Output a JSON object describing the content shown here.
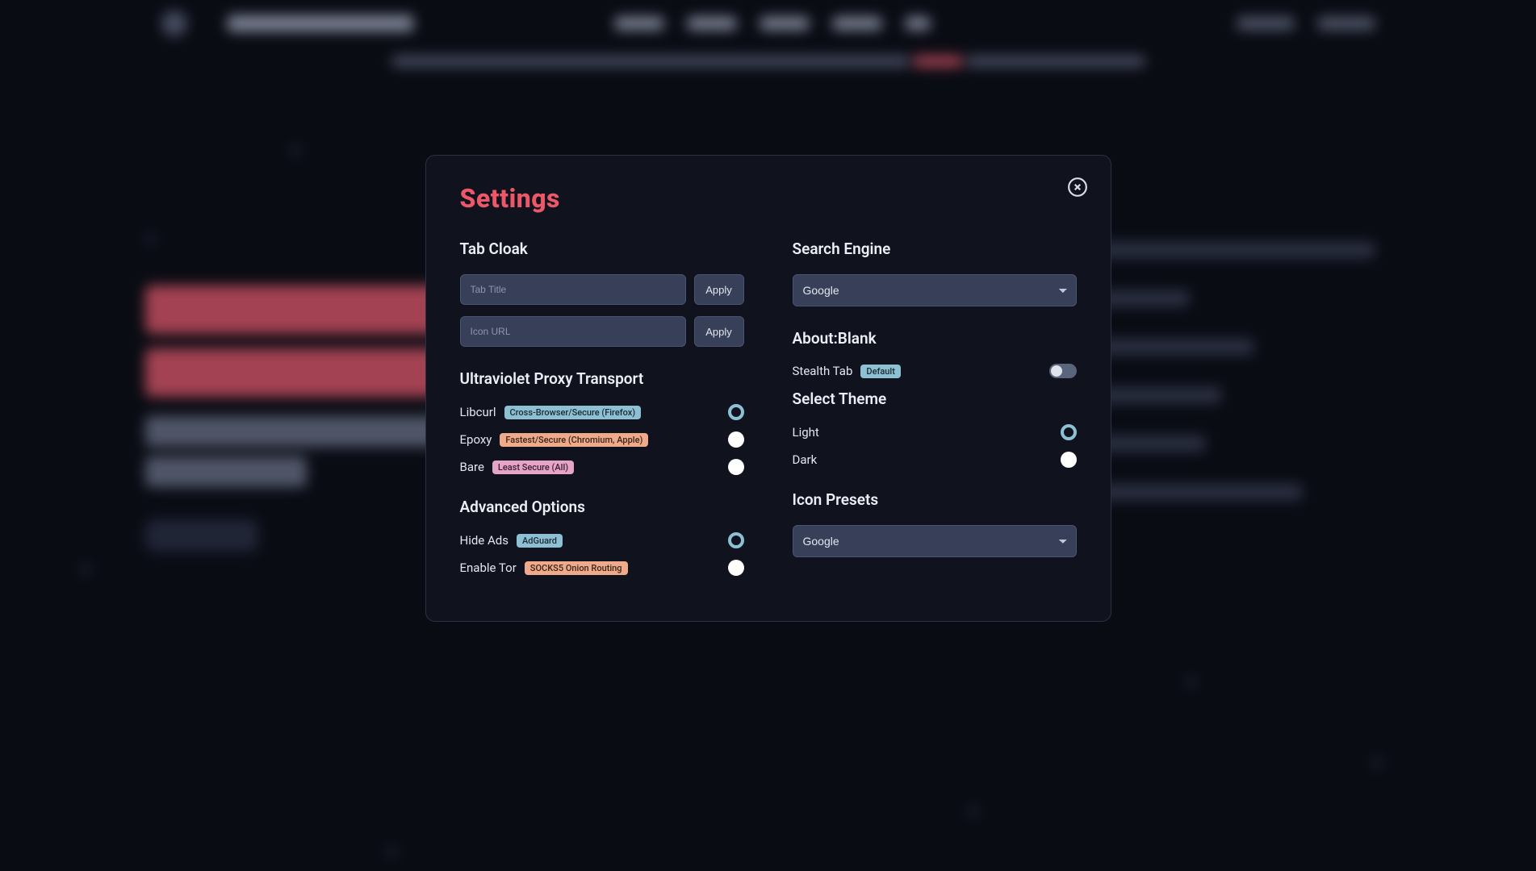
{
  "modal": {
    "title": "Settings",
    "left": {
      "tab_cloak_heading": "Tab Cloak",
      "tab_title_placeholder": "Tab Title",
      "icon_url_placeholder": "Icon URL",
      "apply_label": "Apply",
      "uv_transport_heading": "Ultraviolet Proxy Transport",
      "transports": [
        {
          "name": "Libcurl",
          "badge": "Cross-Browser/Secure (Firefox)",
          "badge_class": "badge-blue",
          "selected": true
        },
        {
          "name": "Epoxy",
          "badge": "Fastest/Secure (Chromium, Apple)",
          "badge_class": "badge-peach",
          "selected": false
        },
        {
          "name": "Bare",
          "badge": "Least Secure (All)",
          "badge_class": "badge-pink",
          "selected": false
        }
      ],
      "advanced_heading": "Advanced Options",
      "advanced": [
        {
          "name": "Hide Ads",
          "badge": "AdGuard",
          "badge_class": "badge-blue",
          "selected": true
        },
        {
          "name": "Enable Tor",
          "badge": "SOCKS5 Onion Routing",
          "badge_class": "badge-peach",
          "selected": false
        }
      ]
    },
    "right": {
      "search_engine_heading": "Search Engine",
      "search_engine_value": "Google",
      "about_blank_heading": "About:Blank",
      "stealth_tab_label": "Stealth Tab",
      "stealth_tab_badge": "Default",
      "theme_heading": "Select Theme",
      "themes": [
        {
          "name": "Light",
          "selected": true
        },
        {
          "name": "Dark",
          "selected": false
        }
      ],
      "icon_presets_heading": "Icon Presets",
      "icon_presets_value": "Google"
    }
  }
}
